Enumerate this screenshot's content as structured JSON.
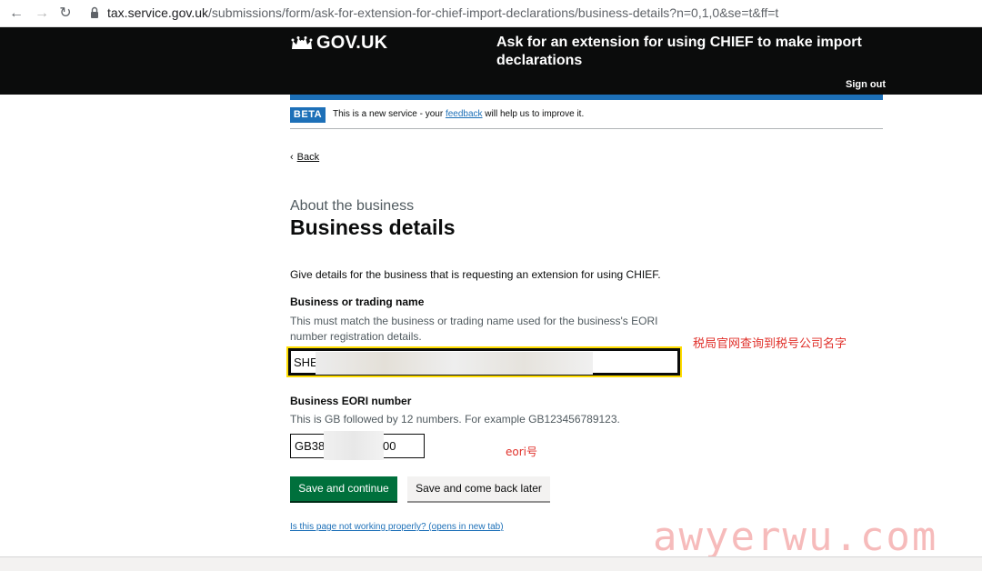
{
  "browser": {
    "url_host": "tax.service.gov.uk",
    "url_path": "/submissions/form/ask-for-extension-for-chief-import-declarations/business-details?n=0,1,0&se=t&ff=t"
  },
  "header": {
    "logo": "GOV.UK",
    "service_name": "Ask for an extension for using CHIEF to make import declarations",
    "sign_out": "Sign out"
  },
  "phase_banner": {
    "tag": "BETA",
    "text_before": "This is a new service - your ",
    "link": "feedback",
    "text_after": " will help us to improve it."
  },
  "back_link": "Back",
  "page": {
    "caption": "About the business",
    "title": "Business details",
    "intro": "Give details for the business that is requesting an extension for using CHIEF."
  },
  "fields": {
    "trading_name": {
      "label": "Business or trading name",
      "hint": "This must match the business or trading name used for the business's EORI number registration details.",
      "value": "SHE"
    },
    "eori": {
      "label": "Business EORI number",
      "hint": "This is GB followed by 12 numbers. For example GB123456789123.",
      "value_start": "GB38",
      "value_end": "00"
    }
  },
  "annotations": {
    "name_note": "税局官网查询到税号公司名字",
    "eori_note": "eori号"
  },
  "buttons": {
    "save_continue": "Save and continue",
    "save_later": "Save and come back later"
  },
  "help_link": "Is this page not working properly? (opens in new tab)",
  "watermark": "awyerwu.com",
  "colors": {
    "header_bg": "#0b0c0c",
    "brand_blue": "#1d70b8",
    "primary_green": "#00703c",
    "focus_yellow": "#ffdd00",
    "annotation_red": "#e0302a"
  }
}
